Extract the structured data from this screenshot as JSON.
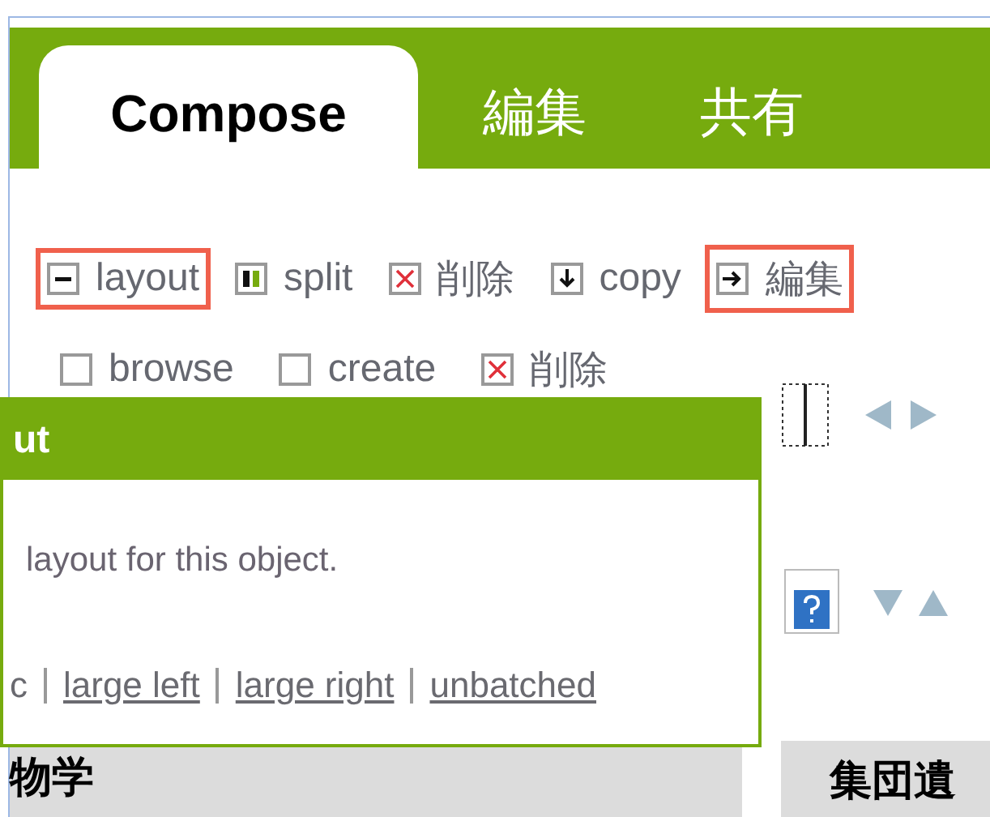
{
  "tabs": [
    {
      "label": "Compose",
      "selected": true
    },
    {
      "label": "編集",
      "selected": false
    },
    {
      "label": "共有",
      "selected": false
    }
  ],
  "toolbar": [
    {
      "label": "layout",
      "kind": "minus",
      "highlighted": true
    },
    {
      "label": "split",
      "kind": "split",
      "highlighted": false
    },
    {
      "label": "削除",
      "kind": "delete",
      "highlighted": false
    },
    {
      "label": "copy",
      "kind": "down",
      "highlighted": false
    },
    {
      "label": "編集",
      "kind": "right",
      "highlighted": true
    }
  ],
  "toolbar_2": [
    {
      "label": "browse",
      "kind": "box"
    },
    {
      "label": "create",
      "kind": "box"
    },
    {
      "label": "削除",
      "kind": "delete"
    }
  ],
  "popup": {
    "title": "ut",
    "description": "layout for this object.",
    "options": [
      {
        "label": "c",
        "kind": "text"
      },
      {
        "label": "large left",
        "kind": "link"
      },
      {
        "label": "large right",
        "kind": "link"
      },
      {
        "label": "unbatched",
        "kind": "link"
      }
    ]
  },
  "sections": [
    {
      "title": "物学"
    },
    {
      "title": "集団遺"
    }
  ]
}
